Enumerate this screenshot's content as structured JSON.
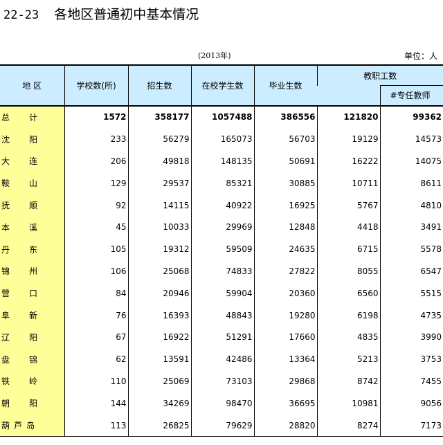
{
  "title": {
    "number": "22-23",
    "text": "各地区普通初中基本情况"
  },
  "subtitle": "(2013年)",
  "unit": "单位：人",
  "columns": {
    "region": "地 区",
    "schools": "学校数(所)",
    "enrollment": "招生数",
    "students": "在校学生数",
    "graduates": "毕业生数",
    "staff": "教职工数",
    "teachers": "#专任教师"
  },
  "rows": [
    {
      "name": "总计",
      "schools": "1572",
      "enrollment": "358177",
      "students": "1057488",
      "graduates": "386556",
      "staff": "121820",
      "teachers": "99362"
    },
    {
      "name": "沈阳",
      "schools": "233",
      "enrollment": "56279",
      "students": "165073",
      "graduates": "56703",
      "staff": "19129",
      "teachers": "14573"
    },
    {
      "name": "大连",
      "schools": "206",
      "enrollment": "49818",
      "students": "148135",
      "graduates": "50691",
      "staff": "16222",
      "teachers": "14075"
    },
    {
      "name": "鞍山",
      "schools": "129",
      "enrollment": "29537",
      "students": "85321",
      "graduates": "30885",
      "staff": "10711",
      "teachers": "8611"
    },
    {
      "name": "抚顺",
      "schools": "92",
      "enrollment": "14115",
      "students": "40922",
      "graduates": "16925",
      "staff": "5767",
      "teachers": "4810"
    },
    {
      "name": "本溪",
      "schools": "45",
      "enrollment": "10033",
      "students": "29969",
      "graduates": "12848",
      "staff": "4418",
      "teachers": "3491"
    },
    {
      "name": "丹东",
      "schools": "105",
      "enrollment": "19312",
      "students": "59509",
      "graduates": "24635",
      "staff": "6715",
      "teachers": "5578"
    },
    {
      "name": "锦州",
      "schools": "106",
      "enrollment": "25068",
      "students": "74833",
      "graduates": "27822",
      "staff": "8055",
      "teachers": "6547"
    },
    {
      "name": "营口",
      "schools": "84",
      "enrollment": "20946",
      "students": "59904",
      "graduates": "20360",
      "staff": "6560",
      "teachers": "5515"
    },
    {
      "name": "阜新",
      "schools": "76",
      "enrollment": "16393",
      "students": "48843",
      "graduates": "19280",
      "staff": "6198",
      "teachers": "4735"
    },
    {
      "name": "辽阳",
      "schools": "67",
      "enrollment": "16922",
      "students": "51291",
      "graduates": "17660",
      "staff": "4835",
      "teachers": "3990"
    },
    {
      "name": "盘锦",
      "schools": "62",
      "enrollment": "13591",
      "students": "42486",
      "graduates": "13364",
      "staff": "5213",
      "teachers": "3753"
    },
    {
      "name": "铁岭",
      "schools": "110",
      "enrollment": "25069",
      "students": "73103",
      "graduates": "29868",
      "staff": "8742",
      "teachers": "7455"
    },
    {
      "name": "朝阳",
      "schools": "144",
      "enrollment": "34269",
      "students": "98470",
      "graduates": "36695",
      "staff": "10981",
      "teachers": "9056"
    },
    {
      "name": "葫芦岛",
      "schools": "113",
      "enrollment": "26825",
      "students": "79629",
      "graduates": "28820",
      "staff": "8274",
      "teachers": "7173"
    }
  ]
}
